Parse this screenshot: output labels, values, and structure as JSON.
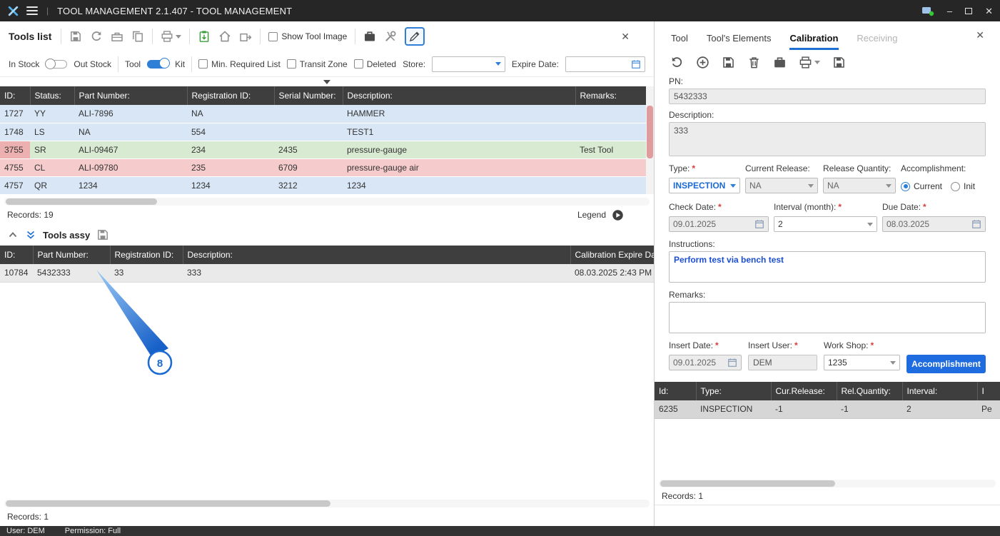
{
  "titlebar": {
    "title": "TOOL MANAGEMENT 2.1.407 - TOOL MANAGEMENT",
    "minimize_label": "–",
    "close_label": "✕"
  },
  "icons": {
    "app_logo": "blue-x-mark",
    "menu": "hamburger",
    "user_status": "badge-with-green-dot",
    "restore": "restore-window-box",
    "save": "floppy-disk",
    "refresh": "circular-arrows",
    "toolbox": "tool-box",
    "copy": "duplicate-pages",
    "print": "printer-with-dropdown",
    "paste": "clipboard-import-green",
    "home": "house",
    "transfer": "box-arrow-out",
    "folder": "dark-briefcase",
    "tools": "crossed-tools",
    "edit": "pencil-active-selected",
    "add": "plus-circle",
    "delete": "trash-can",
    "undo": "refresh-counterclockwise",
    "calendar": "calendar",
    "legend": "circle-play-arrow",
    "collapse": "chevron-up",
    "expand_all": "double-chevron-down"
  },
  "tools_list": {
    "title": "Tools list",
    "show_tool_image": "Show Tool Image",
    "close_label": "✕",
    "filters": {
      "in_stock": "In Stock",
      "out_stock": "Out Stock",
      "tool": "Tool",
      "kit": "Kit",
      "min_required_list": "Min. Required List",
      "transit_zone": "Transit Zone",
      "deleted": "Deleted",
      "store_label": "Store:",
      "expire_date_label": "Expire Date:"
    },
    "table": {
      "columns": [
        "ID:",
        "Status:",
        "Part Number:",
        "Registration ID:",
        "Serial Number:",
        "Description:",
        "Remarks:"
      ],
      "rows": [
        {
          "cells": [
            "1727",
            "YY",
            "ALI-7896",
            "NA",
            "",
            "HAMMER",
            ""
          ],
          "color": "blue"
        },
        {
          "cells": [
            "1748",
            "LS",
            "NA",
            "554",
            "",
            "TEST1",
            ""
          ],
          "color": "blue"
        },
        {
          "cells": [
            "3755",
            "SR",
            "ALI-09467",
            "234",
            "2435",
            "pressure-gauge",
            "Test Tool"
          ],
          "color": "green",
          "id_tint": "red"
        },
        {
          "cells": [
            "4755",
            "CL",
            "ALI-09780",
            "235",
            "6709",
            "pressure-gauge air",
            ""
          ],
          "color": "red"
        },
        {
          "cells": [
            "4757",
            "QR",
            "1234",
            "1234",
            "3212",
            "1234",
            ""
          ],
          "color": "blue"
        }
      ]
    },
    "records": "Records: 19",
    "legend_label": "Legend"
  },
  "tools_assy": {
    "title": "Tools assy",
    "table": {
      "columns": [
        "ID:",
        "Part Number:",
        "Registration ID:",
        "Description:",
        "Calibration Expire Da"
      ],
      "rows": [
        {
          "cells": [
            "10784",
            "5432333",
            "33",
            "333",
            "08.03.2025 2:43 PM"
          ],
          "color": "gray"
        }
      ]
    },
    "records": "Records: 1",
    "callout_number": "8"
  },
  "right_panel": {
    "tabs": [
      "Tool",
      "Tool's Elements",
      "Calibration",
      "Receiving"
    ],
    "active_tab": "Calibration",
    "close_label": "✕",
    "form": {
      "required_marker": "*",
      "pn_label": "PN:",
      "pn_value": "5432333",
      "description_label": "Description:",
      "description_value": "333",
      "type_label": "Type:",
      "type_value": "INSPECTION",
      "current_release_label": "Current Release:",
      "current_release_value": "NA",
      "release_quantity_label": "Release Quantity:",
      "release_quantity_value": "NA",
      "accomplishment_label": "Accomplishment:",
      "radio_current_label": "Current",
      "radio_init_label": "Init",
      "check_date_label": "Check Date:",
      "check_date_value": "09.01.2025",
      "interval_label": "Interval (month):",
      "interval_value": "2",
      "due_date_label": "Due Date:",
      "due_date_value": "08.03.2025",
      "instructions_label": "Instructions:",
      "instructions_value": "Perform test via bench test",
      "remarks_label": "Remarks:",
      "remarks_value": "",
      "insert_date_label": "Insert Date:",
      "insert_date_value": "09.01.2025",
      "insert_user_label": "Insert User:",
      "insert_user_value": "DEM",
      "work_shop_label": "Work Shop:",
      "work_shop_value": "1235",
      "accomplishment_button": "Accomplishment"
    },
    "table": {
      "columns": [
        "Id:",
        "Type:",
        "Cur.Release:",
        "Rel.Quantity:",
        "Interval:",
        "I"
      ],
      "rows": [
        {
          "cells": [
            "6235",
            "INSPECTION",
            "-1",
            "-1",
            "2",
            "Pe"
          ],
          "color": "gray2"
        }
      ]
    },
    "records": "Records: 1"
  },
  "statusbar": {
    "user": "User: DEM",
    "permission": "Permission: Full"
  },
  "colors": {
    "accent_blue": "#1d6fd4",
    "button_blue": "#1f6ce0",
    "row_blue": "#d8e6f6",
    "row_green": "#d9ead2",
    "row_red": "#f6cbcb",
    "header_dark": "#3e3e3e",
    "required_red": "#e03a3a",
    "callout_blue": "#1b69d3"
  }
}
